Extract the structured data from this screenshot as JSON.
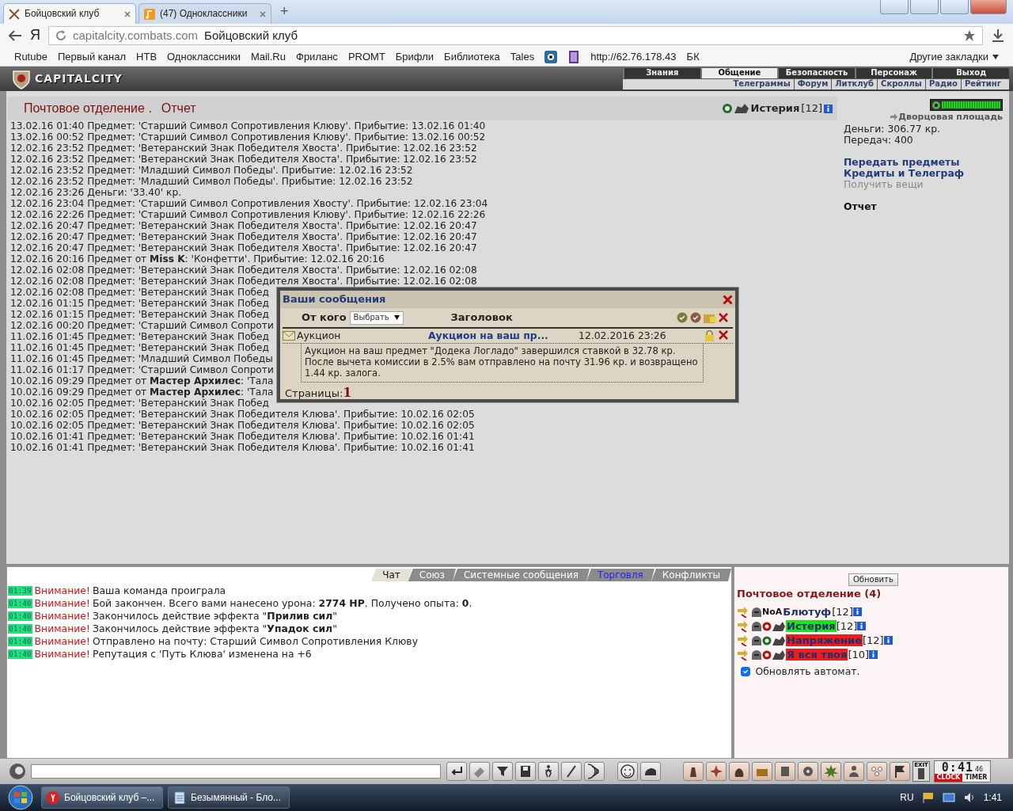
{
  "browser": {
    "tabs": [
      {
        "title": "Бойцовский клуб",
        "selected": true
      },
      {
        "title": "(47) Одноклассники",
        "selected": false
      }
    ],
    "new_tab": "+",
    "yandex": "Я",
    "address": {
      "host": "capitalcity.combats.com",
      "page_title": "Бойцовский клуб"
    },
    "bookmarks": [
      {
        "kind": "text",
        "label": "Rutube"
      },
      {
        "kind": "text",
        "label": "Первый канал"
      },
      {
        "kind": "text",
        "label": "НТВ"
      },
      {
        "kind": "text",
        "label": "Одноклассники"
      },
      {
        "kind": "text",
        "label": "Mail.Ru"
      },
      {
        "kind": "text",
        "label": "Фриланс"
      },
      {
        "kind": "text",
        "label": "PROMT"
      },
      {
        "kind": "text",
        "label": "Брифли"
      },
      {
        "kind": "text",
        "label": "Библиотека"
      },
      {
        "kind": "text",
        "label": "Tales"
      },
      {
        "kind": "icon"
      },
      {
        "kind": "icon"
      },
      {
        "kind": "text",
        "label": "http://62.76.178.43"
      },
      {
        "kind": "text",
        "label": "БК"
      }
    ],
    "other_bookmarks": "Другие закладки"
  },
  "game_header": {
    "logo": "CAPITALCITY",
    "menu": [
      {
        "label": "Знания",
        "selected": false
      },
      {
        "label": "Общение",
        "selected": true
      },
      {
        "label": "Безопасность",
        "selected": false
      },
      {
        "label": "Персонаж",
        "selected": false
      },
      {
        "label": "Выход",
        "selected": false
      }
    ],
    "submenu": [
      "Телеграммы",
      "Форум",
      "Литклуб",
      "Скроллы",
      "Радио",
      "Рейтинг"
    ]
  },
  "post": {
    "title": "Почтовое отделение .",
    "section": "Отчет",
    "user": {
      "name": "Истерия",
      "level": "[12]"
    },
    "log": [
      "13.02.16 01:40 Предмет: 'Старший Символ Сопротивления Клюву'. Прибытие: 13.02.16 01:40",
      "13.02.16 00:52 Предмет: 'Старший Символ Сопротивления Клюву'. Прибытие: 13.02.16 00:52",
      "12.02.16 23:52 Предмет: 'Ветеранский Знак Победителя Хвоста'. Прибытие: 12.02.16 23:52",
      "12.02.16 23:52 Предмет: 'Ветеранский Знак Победителя Хвоста'. Прибытие: 12.02.16 23:52",
      "12.02.16 23:52 Предмет: 'Младший Символ Победы'. Прибытие: 12.02.16 23:52",
      "12.02.16 23:52 Предмет: 'Младший Символ Победы'. Прибытие: 12.02.16 23:52",
      "12.02.16 23:26 Деньги: '33.40' кр.",
      "12.02.16 23:04 Предмет: 'Старший Символ Сопротивления Хвосту'. Прибытие: 12.02.16 23:04",
      "12.02.16 22:26 Предмет: 'Старший Символ Сопротивления Клюву'. Прибытие: 12.02.16 22:26",
      "12.02.16 20:47 Предмет: 'Ветеранский Знак Победителя Хвоста'. Прибытие: 12.02.16 20:47",
      "12.02.16 20:47 Предмет: 'Ветеранский Знак Победителя Хвоста'. Прибытие: 12.02.16 20:47",
      "12.02.16 20:47 Предмет: 'Ветеранский Знак Победителя Хвоста'. Прибытие: 12.02.16 20:47",
      "12.02.16 20:16 Предмет от **Miss K**: 'Конфетти'. Прибытие: 12.02.16 20:16",
      "12.02.16 02:08 Предмет: 'Ветеранский Знак Победителя Хвоста'. Прибытие: 12.02.16 02:08",
      "12.02.16 02:08 Предмет: 'Ветеранский Знак Победителя Хвоста'. Прибытие: 12.02.16 02:08",
      "12.02.16 02:08 Предмет: 'Ветеранский Знак Побед",
      "12.02.16 01:15 Предмет: 'Ветеранский Знак Побед",
      "12.02.16 01:15 Предмет: 'Ветеранский Знак Побед",
      "12.02.16 00:20 Предмет: 'Старший Символ Сопроти",
      "11.02.16 01:45 Предмет: 'Ветеранский Знак Побед",
      "11.02.16 01:45 Предмет: 'Ветеранский Знак Побед",
      "11.02.16 01:45 Предмет: 'Младший Символ Победы",
      "11.02.16 01:17 Предмет: 'Старший Символ Сопроти",
      "10.02.16 09:29 Предмет от **Мастер Архилес**: 'Тала",
      "10.02.16 09:29 Предмет от **Мастер Архилес**: 'Тала",
      "10.02.16 02:05 Предмет: 'Ветеранский Знак Побед",
      "10.02.16 02:05 Предмет: 'Ветеранский Знак Победителя Клюва'. Прибытие: 10.02.16 02:05",
      "10.02.16 02:05 Предмет: 'Ветеранский Знак Победителя Клюва'. Прибытие: 10.02.16 02:05",
      "10.02.16 01:41 Предмет: 'Ветеранский Знак Победителя Клюва'. Прибытие: 10.02.16 01:41",
      "10.02.16 01:41 Предмет: 'Ветеранский Знак Победителя Клюва'. Прибытие: 10.02.16 01:41"
    ],
    "sidebar": {
      "health": {
        "level": 1
      },
      "location": "Дворцовая площадь",
      "money": "Деньги: 306.77 кр.",
      "transfers": "Передач: 400",
      "links": [
        {
          "label": "Передать предметы",
          "selected": false,
          "disabled": false
        },
        {
          "label": "Кредиты и Телеграф",
          "selected": false,
          "disabled": false
        },
        {
          "label": "Получить вещи",
          "selected": false,
          "disabled": true
        },
        {
          "label": "Отчет",
          "selected": true,
          "disabled": false
        }
      ]
    }
  },
  "messages_dialog": {
    "title": "Ваши сообщения",
    "from_label": "От кого",
    "filter": "Выбрать",
    "subject_label": "Заголовок",
    "messages": [
      {
        "from": "Аукцион",
        "subject": "Аукцион на ваш пр...",
        "date": "12.02.2016 23:26",
        "expanded": true,
        "body": "Аукцион на ваш предмет \"Додека Логладо\" завершился ставкой в 32.78 кр. После вычета комиссии в 2.5% вам отправлено на почту 31.96 кр. и возвращено 1.44 кр. залога."
      }
    ],
    "pages_label": "Страницы:",
    "page": "1"
  },
  "chat": {
    "tabs": [
      {
        "label": "Чат",
        "selected": true,
        "highlighted": false
      },
      {
        "label": "Союз",
        "selected": false,
        "highlighted": false
      },
      {
        "label": "Системные сообщения",
        "selected": false,
        "highlighted": false
      },
      {
        "label": "Торговля",
        "selected": false,
        "highlighted": true
      },
      {
        "label": "Конфликты",
        "selected": false,
        "highlighted": false
      }
    ],
    "messages": [
      {
        "time": "01:39",
        "alert": "Внимание!",
        "text": "Ваша команда проиграла"
      },
      {
        "time": "01:40",
        "alert": "Внимание!",
        "text": "Бой закончен. Всего вами нанесено урона: **2774 HP**. Получено опыта: **0**."
      },
      {
        "time": "01:40",
        "alert": "Внимание!",
        "text": "Закончилось действие эффекта \"**Прилив сил**\""
      },
      {
        "time": "01:40",
        "alert": "Внимание!",
        "text": "Закончилось действие эффекта \"**Упадок сил**\""
      },
      {
        "time": "01:40",
        "alert": "Внимание!",
        "text": "Отправлено на почту: Старший Символ Сопротивления Клюву"
      },
      {
        "time": "01:40",
        "alert": "Внимание!",
        "text": "Репутация с 'Путь Клюва' изменена на +6"
      }
    ]
  },
  "online": {
    "refresh": "Обновить",
    "title": "Почтовое отделение (4)",
    "users": [
      {
        "clan": "NoA",
        "name": "Блютуф",
        "level": "[12]"
      },
      {
        "name": "Истерия",
        "level": "[12]",
        "color": "#22dd22"
      },
      {
        "name": "Напряжение",
        "level": "[12]",
        "color": "#ee1c1c"
      },
      {
        "name": "Я вся твоя",
        "level": "[10]",
        "color": "#ee1c1c"
      }
    ],
    "auto_refresh": {
      "label": "Обновлять автомат.",
      "checked": true
    }
  },
  "toolbar": {
    "exit_label": "EXIT",
    "clock": {
      "time": "0:41",
      "seconds": "46",
      "clock_label": "CLOCK",
      "timer_label": "TIMER"
    }
  },
  "taskbar": {
    "windows": [
      {
        "title": "Бойцовский клуб –...",
        "selected": true
      },
      {
        "title": "Безымянный - Бло...",
        "selected": false
      }
    ],
    "language": "RU",
    "time": "1:41"
  }
}
